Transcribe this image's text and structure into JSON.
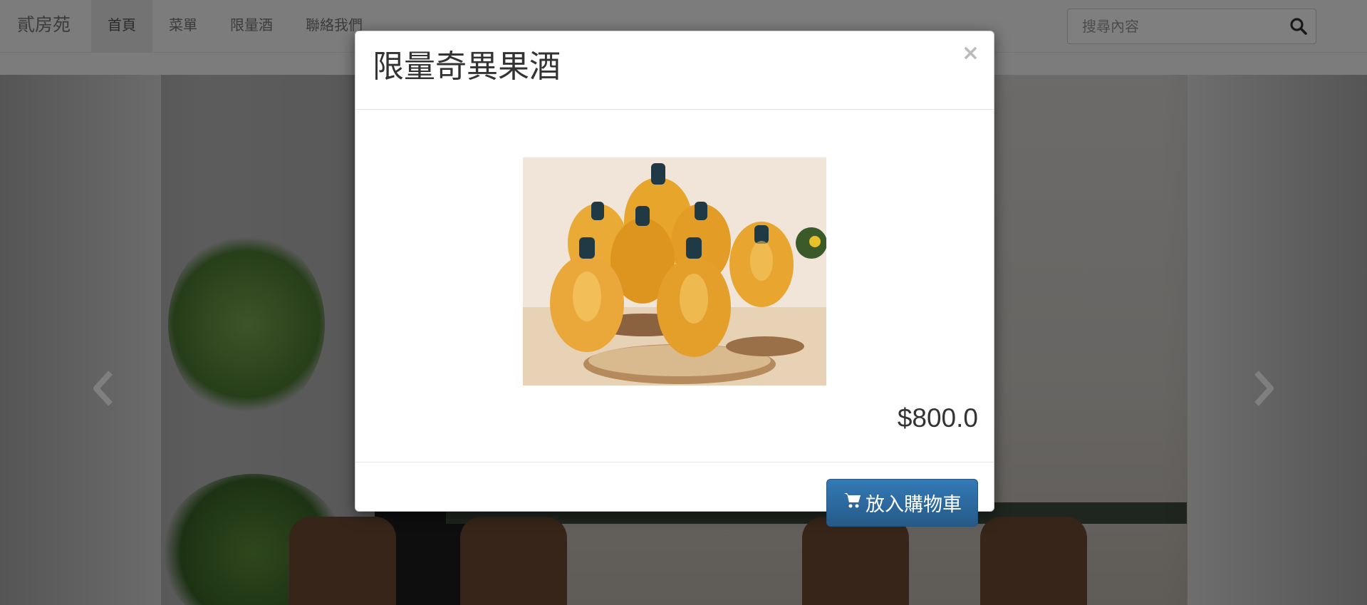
{
  "navbar": {
    "brand": "貳房苑",
    "items": [
      {
        "label": "首頁",
        "active": true
      },
      {
        "label": "菜單",
        "active": false
      },
      {
        "label": "限量酒",
        "active": false
      },
      {
        "label": "聯絡我們",
        "active": false
      }
    ],
    "search": {
      "placeholder": "搜尋內容",
      "value": "",
      "icon": "search-icon"
    }
  },
  "carousel": {
    "prev_icon": "chevron-left-icon",
    "next_icon": "chevron-right-icon"
  },
  "modal": {
    "title": "限量奇異果酒",
    "close_label": "×",
    "price": "$800.0",
    "cart_button_label": "放入購物車",
    "cart_icon": "shopping-cart-icon"
  },
  "colors": {
    "primary_button": "#337ab7",
    "navbar_bg": "#f8f8f8",
    "backdrop": "rgba(0,0,0,0.5)"
  }
}
